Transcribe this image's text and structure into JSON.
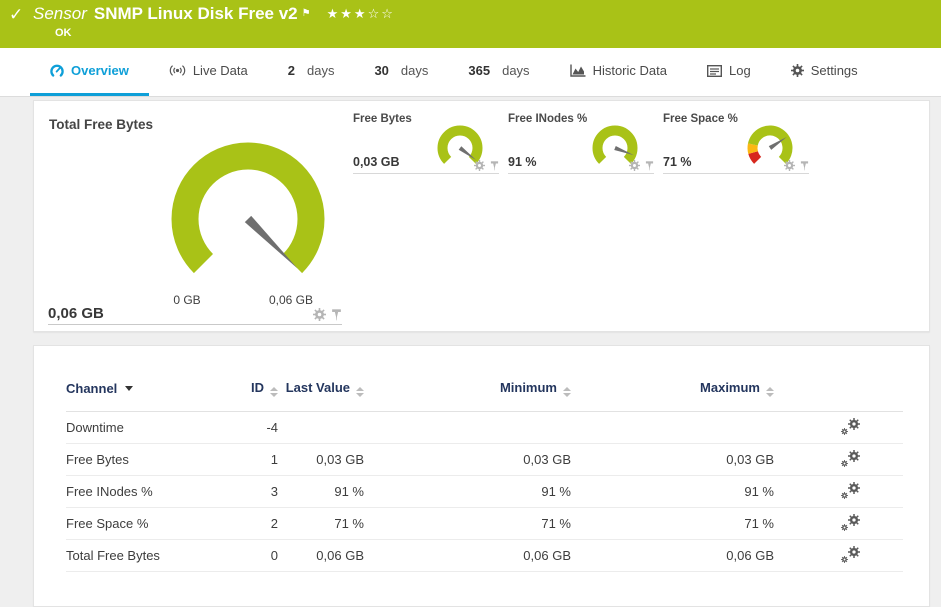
{
  "header": {
    "kind_label": "Sensor",
    "title": "SNMP Linux Disk Free v2",
    "status": "OK",
    "rating": {
      "filled": 3,
      "total": 5
    }
  },
  "tabs": [
    {
      "label": "Overview",
      "active": true
    },
    {
      "label": "Live Data"
    },
    {
      "value": "2",
      "unit": "days"
    },
    {
      "value": "30",
      "unit": "days"
    },
    {
      "value": "365",
      "unit": "days"
    },
    {
      "label": "Historic Data"
    },
    {
      "label": "Log"
    },
    {
      "label": "Settings"
    }
  ],
  "gauges": {
    "main": {
      "title": "Total Free Bytes",
      "value": "0,06 GB",
      "scale_min": "0 GB",
      "scale_max": "0,06 GB",
      "fraction": 1.0
    },
    "small": [
      {
        "title": "Free Bytes",
        "value": "0,03 GB",
        "fraction": 0.97
      },
      {
        "title": "Free INodes %",
        "value": "91 %",
        "fraction": 0.91
      },
      {
        "title": "Free Space %",
        "value": "71 %",
        "fraction": 0.71,
        "segments": [
          {
            "to": 0.11,
            "color": "#d7281e"
          },
          {
            "to": 0.21,
            "color": "#fcb813"
          },
          {
            "to": 1,
            "color": "#a9c217"
          }
        ]
      }
    ]
  },
  "table": {
    "columns": [
      "Channel",
      "ID",
      "Last Value",
      "Minimum",
      "Maximum"
    ],
    "rows": [
      {
        "channel": "Downtime",
        "id": "-4",
        "last": "",
        "min": "",
        "max": ""
      },
      {
        "channel": "Free Bytes",
        "id": "1",
        "last": "0,03 GB",
        "min": "0,03 GB",
        "max": "0,03 GB"
      },
      {
        "channel": "Free INodes %",
        "id": "3",
        "last": "91 %",
        "min": "91 %",
        "max": "91 %"
      },
      {
        "channel": "Free Space %",
        "id": "2",
        "last": "71 %",
        "min": "71 %",
        "max": "71 %"
      },
      {
        "channel": "Total Free Bytes",
        "id": "0",
        "last": "0,06 GB",
        "min": "0,06 GB",
        "max": "0,06 GB"
      }
    ]
  },
  "colors": {
    "accent_green": "#a9c217",
    "gauge_green": "#a9c217",
    "tab_blue": "#0e9fd8",
    "header_navy": "#24365e",
    "needle_gray": "#6f6f6f",
    "warn_yellow": "#fcb813",
    "error_red": "#d7281e"
  }
}
